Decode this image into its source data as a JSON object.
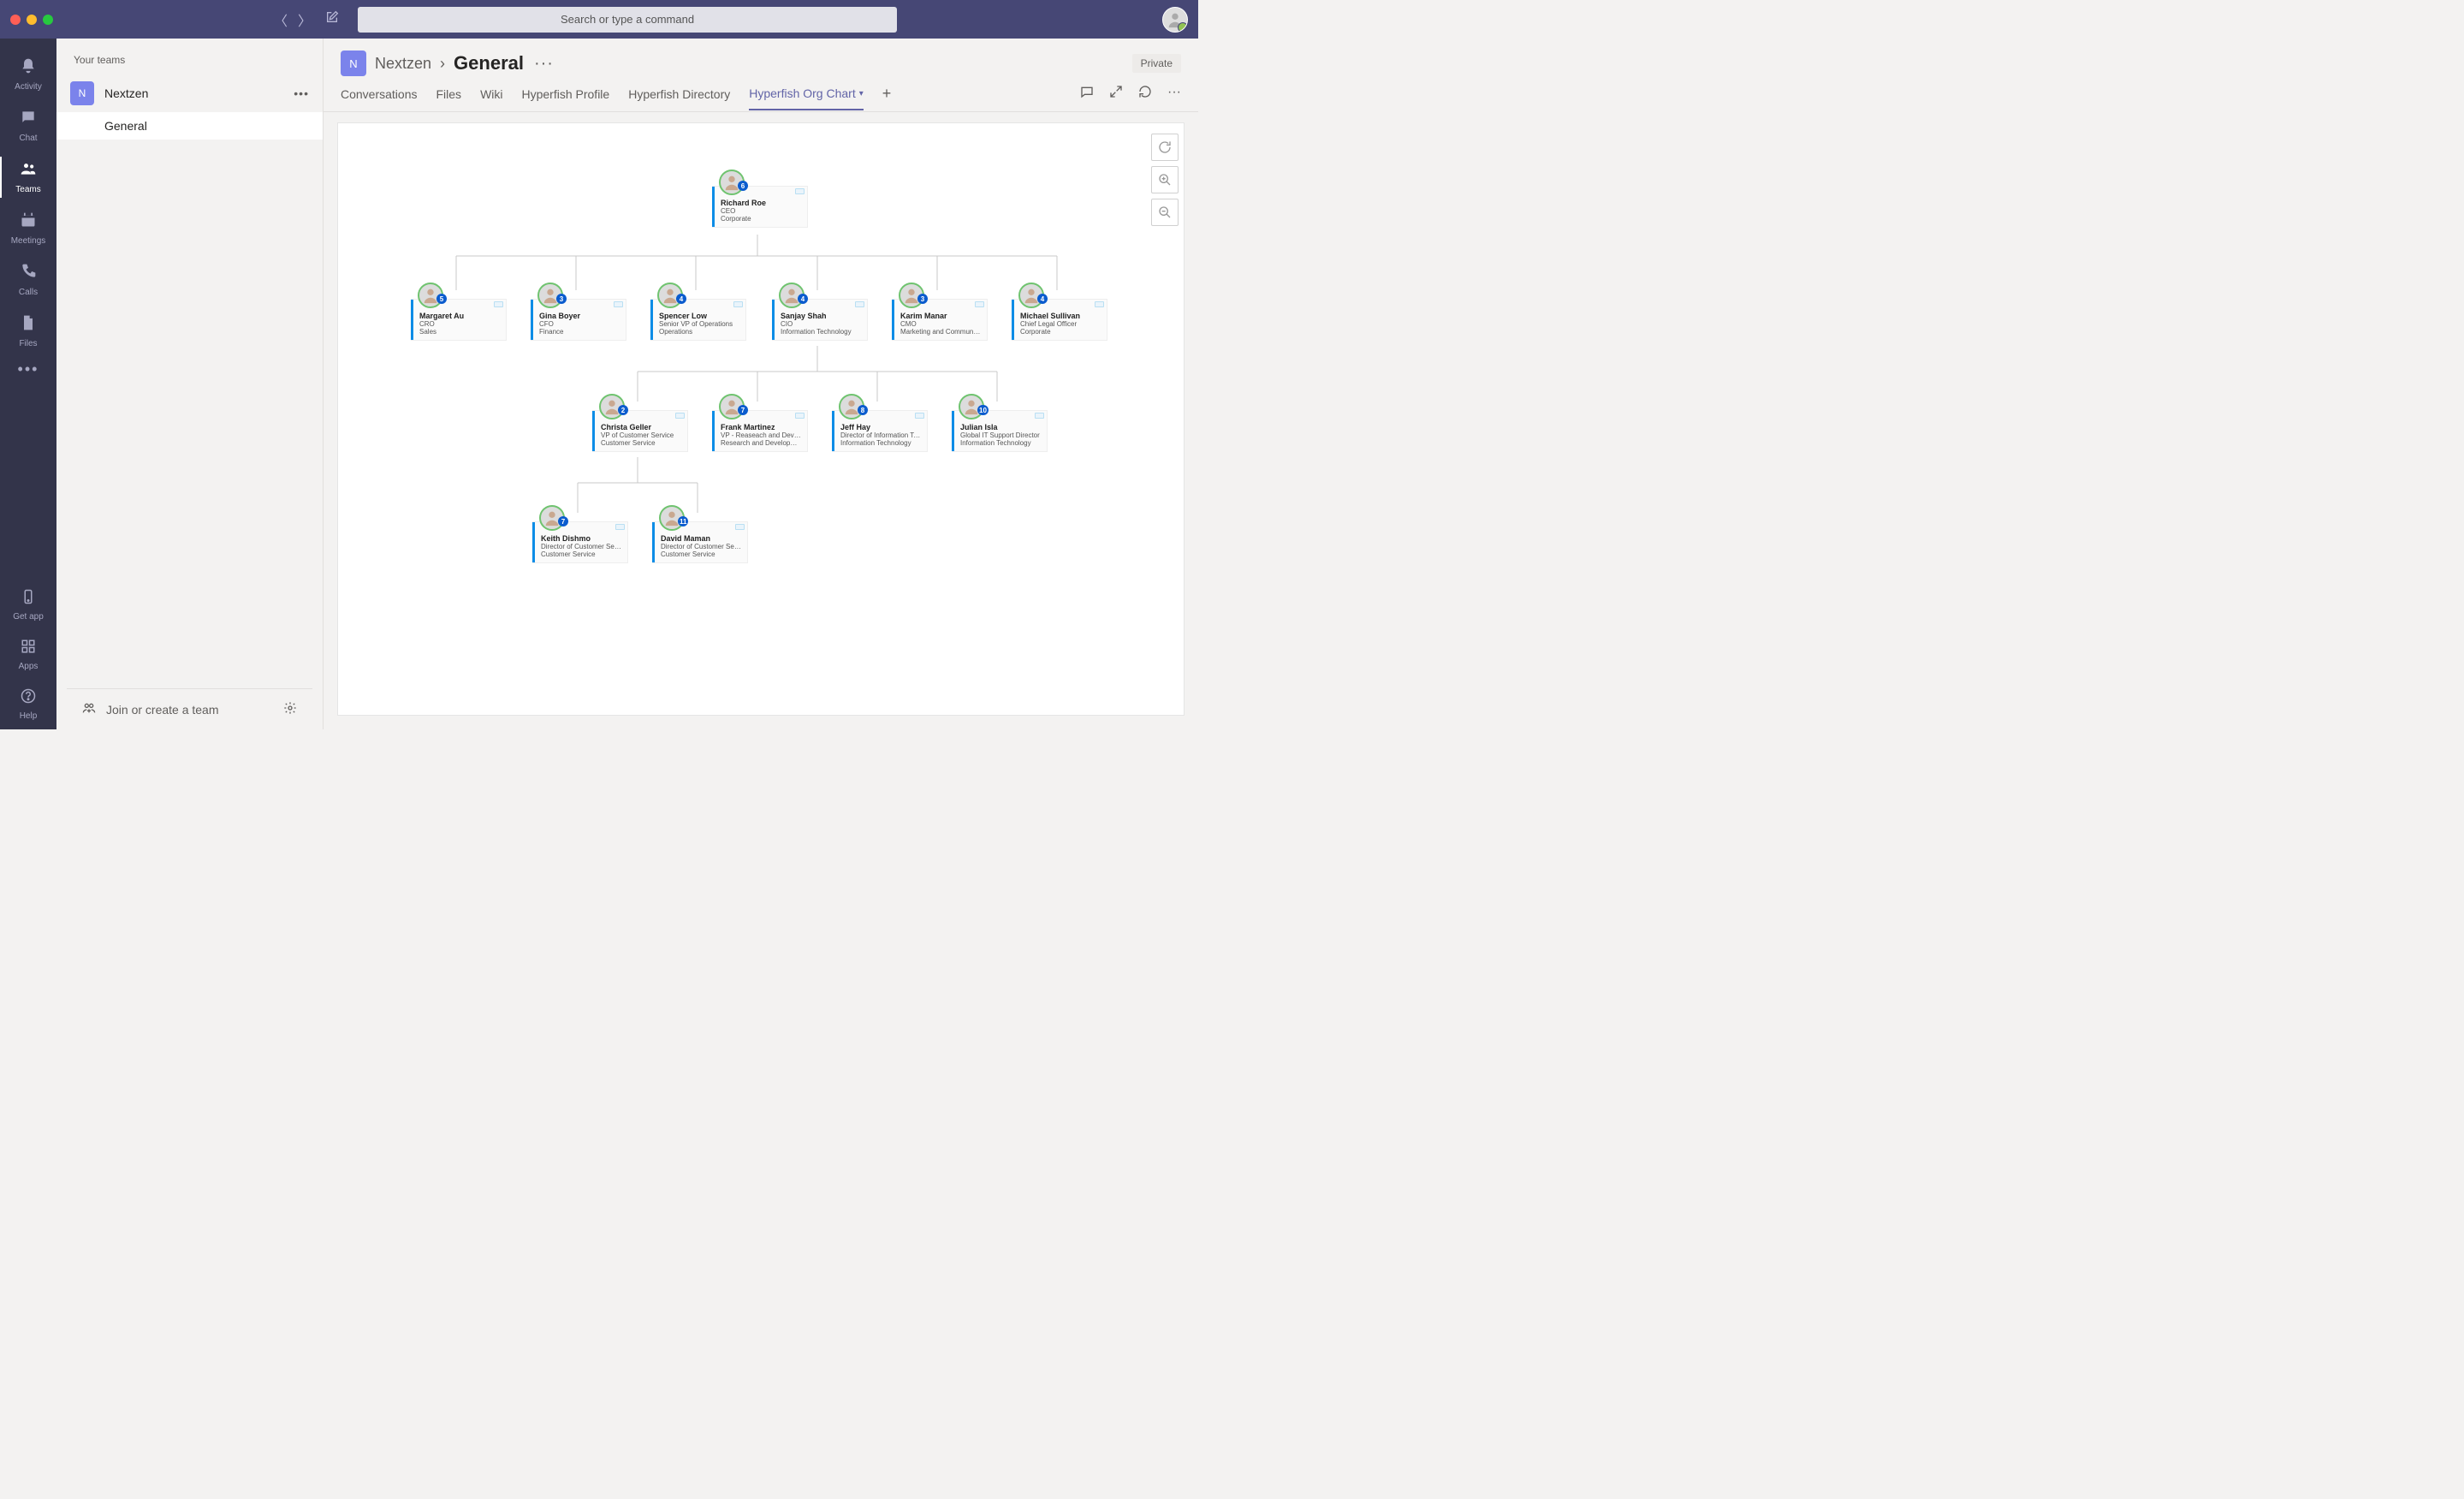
{
  "titlebar": {
    "search_placeholder": "Search or type a command"
  },
  "rail": {
    "activity": "Activity",
    "chat": "Chat",
    "teams": "Teams",
    "meetings": "Meetings",
    "calls": "Calls",
    "files": "Files",
    "getapp": "Get app",
    "apps": "Apps",
    "help": "Help"
  },
  "sidebar": {
    "header": "Your teams",
    "team": {
      "initial": "N",
      "name": "Nextzen"
    },
    "channels": [
      {
        "name": "General"
      }
    ],
    "footer": {
      "join": "Join or create a team"
    }
  },
  "header": {
    "tile": "N",
    "team": "Nextzen",
    "channel": "General",
    "privacy": "Private"
  },
  "tabs": {
    "conversations": "Conversations",
    "files": "Files",
    "wiki": "Wiki",
    "hprofile": "Hyperfish Profile",
    "hdir": "Hyperfish Directory",
    "horg": "Hyperfish Org Chart"
  },
  "org": {
    "root": {
      "name": "Richard Roe",
      "title": "CEO",
      "dept": "Corporate",
      "badge": "6"
    },
    "l2": [
      {
        "name": "Margaret Au",
        "title": "CRO",
        "dept": "Sales",
        "badge": "5"
      },
      {
        "name": "Gina Boyer",
        "title": "CFO",
        "dept": "Finance",
        "badge": "3"
      },
      {
        "name": "Spencer Low",
        "title": "Senior VP of Operations",
        "dept": "Operations",
        "badge": "4"
      },
      {
        "name": "Sanjay Shah",
        "title": "CIO",
        "dept": "Information Technology",
        "badge": "4"
      },
      {
        "name": "Karim Manar",
        "title": "CMO",
        "dept": "Marketing and Communicati...",
        "badge": "3"
      },
      {
        "name": "Michael Sullivan",
        "title": "Chief Legal Officer",
        "dept": "Corporate",
        "badge": "4"
      }
    ],
    "l3": [
      {
        "name": "Christa Geller",
        "title": "VP of Customer Service",
        "dept": "Customer Service",
        "badge": "2"
      },
      {
        "name": "Frank Martinez",
        "title": "VP - Reaseach and Develop...",
        "dept": "Research and Development",
        "badge": "7"
      },
      {
        "name": "Jeff Hay",
        "title": "Director of Information Tech...",
        "dept": "Information Technology",
        "badge": "8"
      },
      {
        "name": "Julian Isla",
        "title": "Global IT Support Director",
        "dept": "Information Technology",
        "badge": "10"
      }
    ],
    "l4": [
      {
        "name": "Keith Dishmo",
        "title": "Director of Customer Service",
        "dept": "Customer Service",
        "badge": "7"
      },
      {
        "name": "David Maman",
        "title": "Director of Customer Servic...",
        "dept": "Customer Service",
        "badge": "11"
      }
    ]
  }
}
